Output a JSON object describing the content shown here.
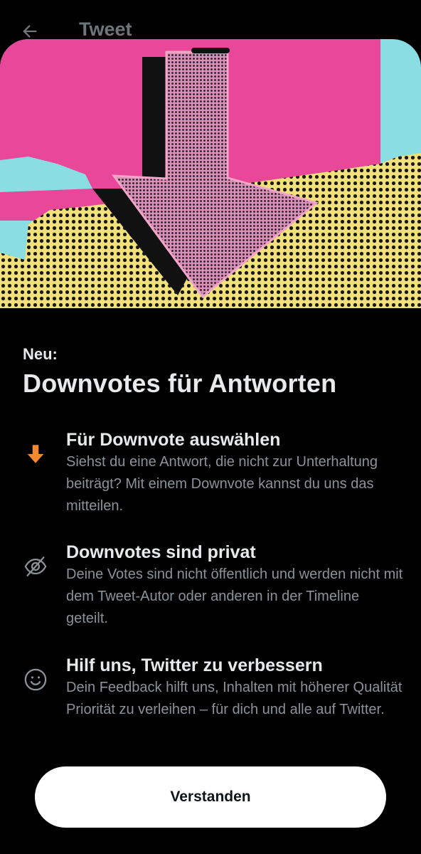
{
  "header": {
    "title": "Tweet",
    "back_icon": "arrow-left-icon"
  },
  "sheet": {
    "hero_icon": "downvote-arrow-illustration",
    "colors": {
      "pink": "#e8479a",
      "cyan": "#8adde3",
      "yellow": "#f2e07a",
      "accent_orange": "#f4892f"
    },
    "eyebrow": "Neu:",
    "headline": "Downvotes für Antworten",
    "features": [
      {
        "icon": "downvote-arrow-icon",
        "title": "Für Downvote auswählen",
        "description": "Siehst du eine Antwort, die nicht zur Unterhaltung beiträgt? Mit einem Downvote kannst du uns das mitteilen."
      },
      {
        "icon": "eye-slash-icon",
        "title": "Downvotes sind privat",
        "description": "Deine Votes sind nicht öffentlich und werden nicht mit dem Tweet-Autor oder anderen in der Timeline geteilt."
      },
      {
        "icon": "smiley-icon",
        "title": "Hilf uns, Twitter zu verbessern",
        "description": "Dein Feedback hilft uns, Inhalten mit höherer Qualität Priorität zu verleihen – für dich und alle auf Twitter."
      }
    ],
    "cta_label": "Verstanden"
  }
}
